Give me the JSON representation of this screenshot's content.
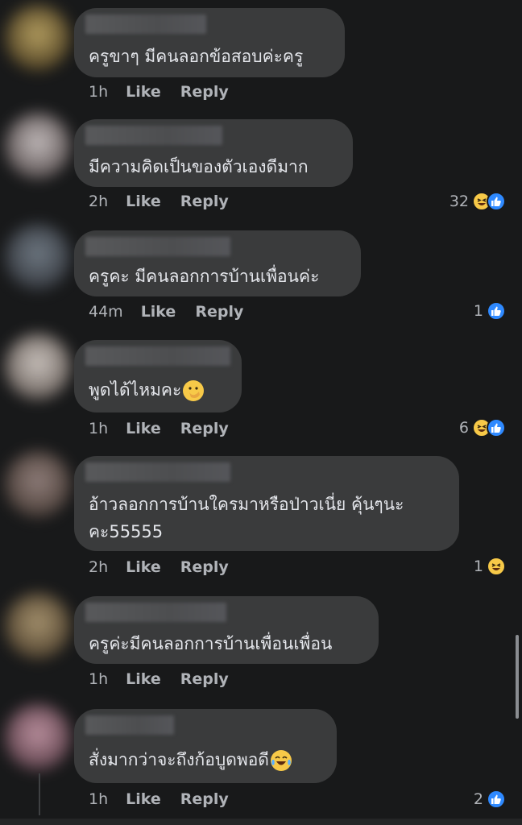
{
  "comments": [
    {
      "text": "ครูขาๆ มีคนลอกข้อสอบค่ะครู",
      "time": "1h",
      "like_label": "Like",
      "reply_label": "Reply",
      "reaction_count": "",
      "reactions": [],
      "avatar_color": "#8a7a4a"
    },
    {
      "text": "มีความคิดเป็นของตัวเองดีมาก",
      "time": "2h",
      "like_label": "Like",
      "reply_label": "Reply",
      "reaction_count": "32",
      "reactions": [
        "haha",
        "like"
      ],
      "avatar_color": "#9a9090"
    },
    {
      "text": "ครูคะ มีคนลอกการบ้านเพื่อนค่ะ",
      "time": "44m",
      "like_label": "Like",
      "reply_label": "Reply",
      "reaction_count": "1",
      "reactions": [
        "like"
      ],
      "avatar_color": "#5a5f66"
    },
    {
      "text": "พูดได้ไหมคะ",
      "time": "1h",
      "like_label": "Like",
      "reply_label": "Reply",
      "reaction_count": "6",
      "reactions": [
        "haha",
        "like"
      ],
      "avatar_color": "#a09a96"
    },
    {
      "text_line1": "อ้าวลอกการบ้านใครมาหรือป่าวเนี่ย คุ้นๆนะ",
      "text_line2": "คะ55555",
      "time": "2h",
      "like_label": "Like",
      "reply_label": "Reply",
      "reaction_count": "1",
      "reactions": [
        "haha"
      ],
      "avatar_color": "#6e5a5a"
    },
    {
      "text": "ครูค่ะมีคนลอกการบ้านเพื่อนเพื่อน",
      "time": "1h",
      "like_label": "Like",
      "reply_label": "Reply",
      "reaction_count": "",
      "reactions": [],
      "avatar_color": "#7a6a55"
    },
    {
      "text": "สั่งมากว่าจะถึงก้อบูดพอดี",
      "time": "1h",
      "like_label": "Like",
      "reply_label": "Reply",
      "reaction_count": "2",
      "reactions": [
        "like"
      ],
      "avatar_color": "#9a7080"
    }
  ],
  "colors": {
    "background": "#18191a",
    "bubble": "#3a3b3c",
    "text": "#e4e6eb",
    "meta": "#b0b3b8",
    "like_blue": "#2e89ff",
    "haha_yellow": "#f7c948"
  },
  "icons": {
    "like": "thumbs-up-icon",
    "haha": "laughing-face-icon",
    "hand_over_mouth": "face-with-hand-over-mouth-icon",
    "tears_of_joy": "face-with-tears-of-joy-icon"
  }
}
